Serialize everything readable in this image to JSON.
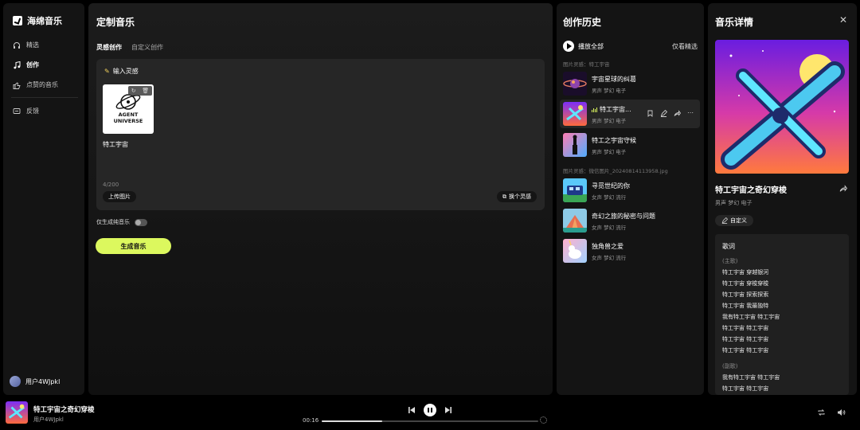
{
  "app": {
    "name": "海绵音乐"
  },
  "sidebar": {
    "items": [
      {
        "label": "精选",
        "icon": "headphones-icon"
      },
      {
        "label": "创作",
        "icon": "music-note-icon",
        "active": true
      },
      {
        "label": "点赞的音乐",
        "icon": "thumbs-up-icon"
      },
      {
        "label": "反馈",
        "icon": "feedback-icon"
      }
    ],
    "user": "用户4WJpkl"
  },
  "main": {
    "title": "定制音乐",
    "tabs": [
      {
        "label": "灵感创作",
        "active": true
      },
      {
        "label": "自定义创作"
      }
    ],
    "input_title": "输入灵感",
    "image_logo_text": [
      "AGENT",
      "UNIVERSE"
    ],
    "image_caption": "特工宇宙",
    "counter": "4/200",
    "upload_label": "上传图片",
    "shuffle_label": "换个灵感",
    "toggle_label": "仅生成纯音乐",
    "generate_label": "生成音乐"
  },
  "history": {
    "title": "创作历史",
    "play_all": "播放全部",
    "only_picks": "仅看精选",
    "groups": [
      {
        "label": "图片灵感：特工宇宙",
        "songs": [
          {
            "title": "宇宙星球的纠葛",
            "tags": "男声 梦幻 电子"
          },
          {
            "title": "特工宇宙...",
            "tags": "男声 梦幻 电子",
            "active": true
          },
          {
            "title": "特工之宇宙守候",
            "tags": "男声 梦幻 电子"
          }
        ]
      },
      {
        "label": "图片灵感：微信图片_20240814113958.jpg",
        "songs": [
          {
            "title": "寻觅世纪的你",
            "tags": "女声 梦幻 流行"
          },
          {
            "title": "奇幻之旅的秘密与问题",
            "tags": "女声 梦幻 流行"
          },
          {
            "title": "独角兽之爱",
            "tags": "女声 梦幻 流行"
          }
        ]
      }
    ]
  },
  "detail": {
    "title": "音乐详情",
    "song_title": "特工宇宙之奇幻穿梭",
    "tags": "男声 梦幻 电子",
    "custom_label": "自定义",
    "lyrics_title": "歌词",
    "lyrics": [
      {
        "section": "(主歌)",
        "lines": [
          "特工宇宙 穿越银河",
          "特工宇宙 穿梭穿梭",
          "特工宇宙 探索探索",
          "特工宇宙 我最独特",
          "我有特工宇宙 特工宇宙",
          "特工宇宙 特工宇宙",
          "特工宇宙 特工宇宙",
          "特工宇宙 特工宇宙"
        ]
      },
      {
        "section": "(副歌)",
        "lines": [
          "我有特工宇宙 特工宇宙",
          "特工宇宙 特工宇宙"
        ]
      }
    ]
  },
  "player": {
    "title": "特工宇宙之奇幻穿梭",
    "user": "用户4WJpkl",
    "time": "00:16",
    "progress": 0.28
  },
  "colors": {
    "accent": "#dcf85e",
    "bg": "#000000",
    "panel": "#141414"
  }
}
